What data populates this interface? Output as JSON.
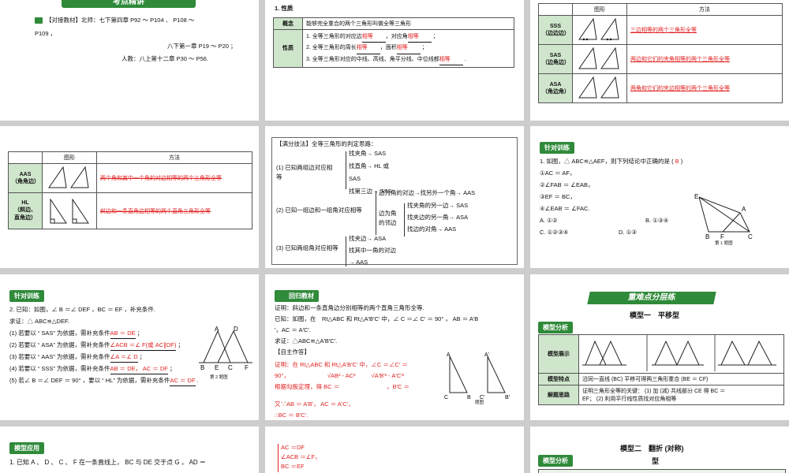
{
  "s1": {
    "banner": "考点精讲",
    "line1": "【对接教材】北师：七下第四章 P92 ～ P104 、 P108 ～",
    "line2": "P109 ，",
    "line3": "八下第一章 P19 ～ P20 ；",
    "line4": "人教：八上第十二章 P30 ～ P56."
  },
  "s2": {
    "heading": "1. 性质",
    "r1_head": "概念",
    "r1_text": "能够完全重合的两个三角形叫做全等三角形",
    "r2_head": "性质",
    "p1a": "1. 全等三角形的对应边",
    "p1b": "相等",
    "p1c": "，对应角",
    "p1d": "相等",
    "p2a": "2. 全等三角形的周长",
    "p2b": "相等",
    "p2c": "，面积",
    "p2d": "相等",
    "p3a": "3. 全等三角形对应的中线、高线、角平分线、中位线都",
    "p3b": "相等"
  },
  "s3": {
    "h_fig": "图形",
    "h_method": "方法",
    "rows": [
      {
        "name": "SSS",
        "sub": "（边边边）",
        "method": "三边相等的两个三角形全等"
      },
      {
        "name": "SAS",
        "sub": "（边角边）",
        "method": "两边和它们的夹角相等的两个三角形全等"
      },
      {
        "name": "ASA",
        "sub": "（角边角）",
        "method": "两角和它们的夹边相等的两个三角形全等"
      }
    ]
  },
  "s4": {
    "h_fig": "图形",
    "h_method": "方法",
    "r1_name": "AAS",
    "r1_sub": "（角角边）",
    "r1_method": "两个角和其中一个角的对边相等的两个三角形全等",
    "r2_name": "HL",
    "r2_sub": "（斜边、",
    "r2_sub2": "直角边）",
    "r2_method": "斜边和一条直角边相等的两个直角三角形全等"
  },
  "s5": {
    "title": "【满分技法】全等三角形的判定思路：",
    "g1": "(1) 已知两组边对应相",
    "g1b": "等",
    "g1_1": "找夹角→ SAS",
    "g1_2": "找直角→ HL 或",
    "g1_3": "SAS",
    "g1_4": "找第三边→ SSS",
    "g2": "(2) 已知一组边和一组角对应相等",
    "g2_1": "边为角的对边→找另外一个角→ AAS",
    "g2_2": "边为角",
    "g2_3": "的邻边",
    "g2_4": "找夹角的另一边→ SAS",
    "g2_5": "找夹边的另一角→ ASA",
    "g2_6": "找边的对角→ AAS",
    "g3": "(3) 已知两组角对应相等",
    "g3_1": "找夹边→ ASA",
    "g3_2": "找其中一角的对边",
    "g3_3": "→ AAS"
  },
  "s6": {
    "badge": "针对训练",
    "q": "1. 如图，△ ABC≌△AEF，则下列结论中正确的是 (",
    "ans": "B",
    "q_end": ")",
    "o1": "①AC ＝ AF，",
    "o2": "②∠FAB ＝ ∠EAB，",
    "o3": "③EF ＝ BC，",
    "o4": "④∠EAB ＝ ∠FAC.",
    "A": "A. ①②",
    "B": "B. ①③④",
    "C": "C. ①②③④",
    "D": "D. ①③",
    "cap": "第 1 题图",
    "labels": {
      "E": "E",
      "A": "A",
      "B": "B",
      "F": "F",
      "C": "C"
    }
  },
  "s7": {
    "badge": "针对训练",
    "q": "2. 已知：如图，∠ B ＝∠ DEF ，BC ＝ EF ，补充条件.",
    "prove": "求证：△ ABC≌△DEF.",
    "l1": "(1) 若要以 “ SAS” 为依据，需补充条件",
    "a1": "AB ＝ DE",
    "l2": "(2) 若要以 “ ASA” 为依据，需补充条件",
    "a2": "∠ACB ＝∠ F(或 AC∥DF)",
    "l3": "(3) 若要以 “ AAS” 为依据，需补充条件",
    "a3": "∠A ＝∠ D",
    "l4": "(4) 若要以 “ SSS” 为依据，需补充条件",
    "a4": "AB ＝ DE， AC ＝ DF",
    "l5": "(5) 若∠ B ＝∠ DEF ＝ 90° ，要以 “ HL” 为依据，需补充条件",
    "a5": "AC ＝ DF",
    "cap": "第 2 题图",
    "labels": {
      "A": "A",
      "D": "D",
      "B": "B",
      "E": "E",
      "C": "C",
      "F": "F"
    }
  },
  "s8": {
    "badge": "回归教材",
    "l1": "证明：斜边和一条直角边分别相等的两个直角三角形全等.",
    "l2": "已知：如图，在　Rt△ABC 和 Rt△A′B′C′ 中，∠ C ＝∠ C′ ＝ 90° ， AB ＝ A′B",
    "l3": "′，AC ＝ A′C′.",
    "l4": "求证：△ABC≌△A′B′C′.",
    "l5": "【自主作答】",
    "r1": "证明：在 Rt△ABC 和 Rt△A′B′C′ 中，∠C ＝∠C′ ＝",
    "r2": "90°，",
    "r2b": "√AB² - AC²",
    "r2c": "√A′B′² - A′C′²",
    "r3": "根据勾股定理，得 BC ＝",
    "r3b": "，B′C ＝",
    "r4": "又∵AB ＝ A′B′， AC ＝ A′C′，",
    "r5": "∴BC ＝ B′C′.",
    "cap": "题图",
    "labels": {
      "A": "A",
      "B": "B",
      "C": "C",
      "A2": "A′",
      "B2": "B′",
      "C2": "C′"
    }
  },
  "s9": {
    "banner": "重难点分层练",
    "model": "模型一　平移型",
    "badge": "模型分析",
    "h1": "模型展示",
    "h2": "模型特点",
    "t2": "沿同一直线 (BC) 平移可得两三角形重合 (BE ＝ CF)",
    "h3": "解题思路",
    "t3a": "证明三角形全等的关键： (1) 加 (减) 共线部分 CE 得 BC ＝",
    "t3b": "EF； (2) 利用平行线性质找对应角相等"
  },
  "s10": {
    "badge": "模型应用",
    "q": "1. 已知 A 、 D 、 C 、 F 在一条直线上， BC 与 DE 交于点 G ， AD ＝"
  },
  "s11": {
    "l1": "AC ＝DF",
    "l2": "∠ACB ＝∠F，",
    "l3": "BC ＝EF"
  },
  "s12": {
    "model": "模型二　翻折 (对称)",
    "model2": "型",
    "badge": "模型分析"
  }
}
